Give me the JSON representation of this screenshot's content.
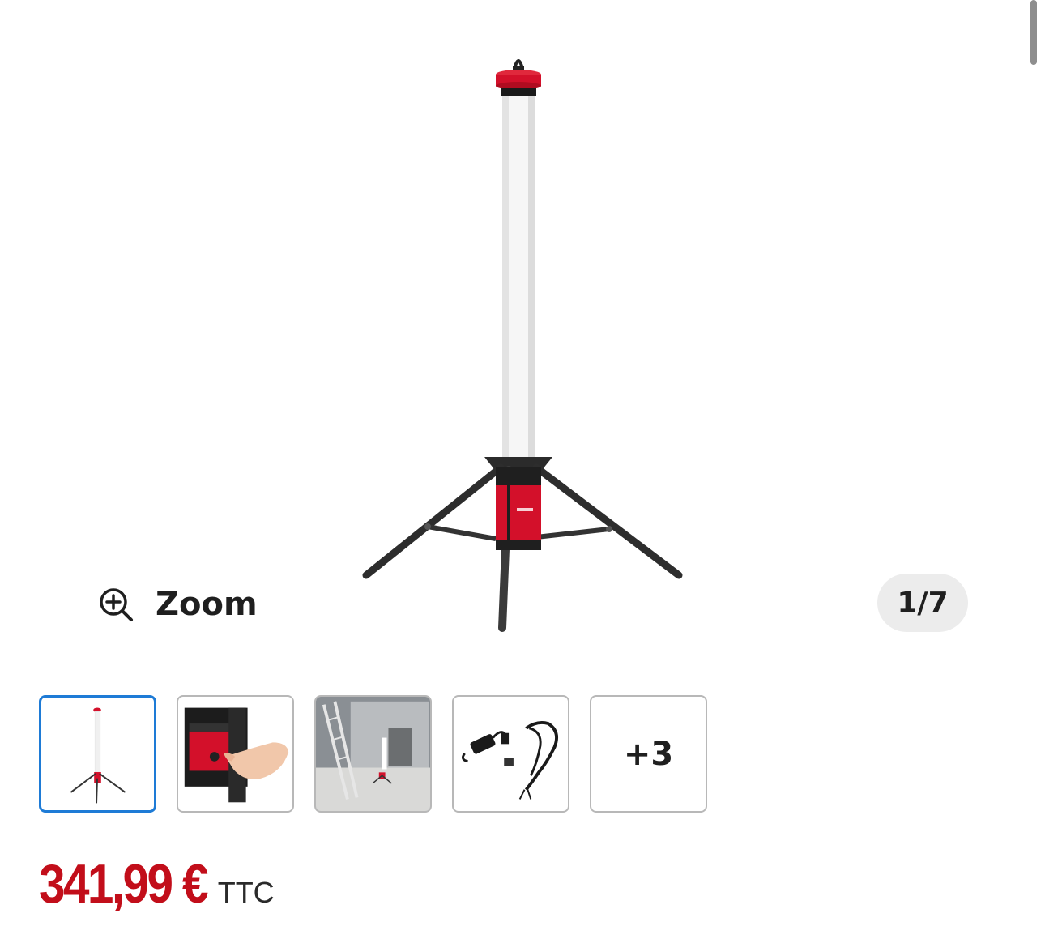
{
  "gallery": {
    "zoom_label": "Zoom",
    "counter": "1/7",
    "more_label": "+3",
    "thumbnails": [
      {
        "name": "thumb-lamp-tripod",
        "active": true
      },
      {
        "name": "thumb-control-panel"
      },
      {
        "name": "thumb-room-scene"
      },
      {
        "name": "thumb-accessories"
      }
    ]
  },
  "product": {
    "price": "341,99 €",
    "tax_label": "TTC",
    "brand_color": "#d3102a",
    "price_color": "#c20e1a"
  },
  "icons": {
    "zoom": "zoom-in-icon"
  }
}
